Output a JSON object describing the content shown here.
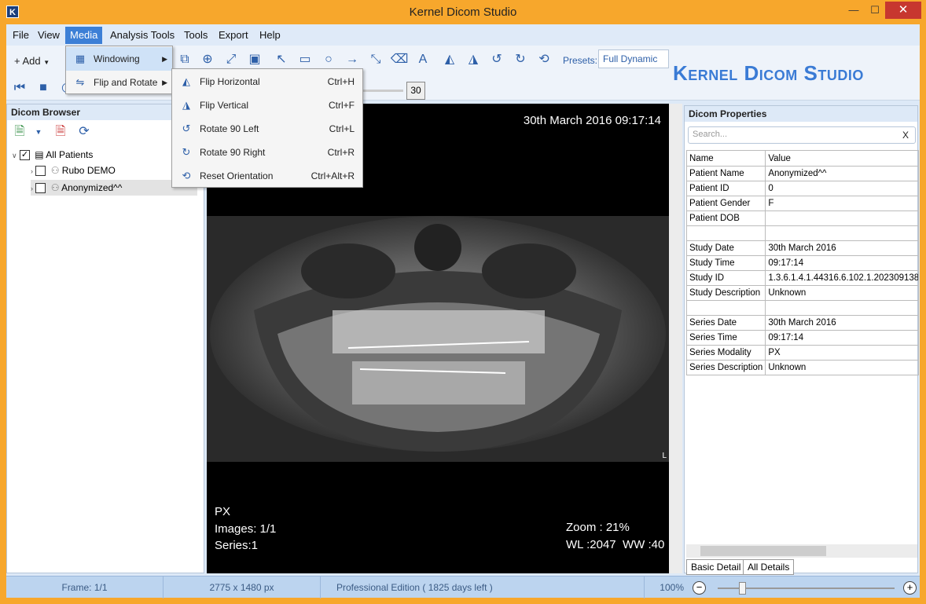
{
  "window": {
    "title": "Kernel Dicom Studio",
    "app_icon_letter": "K",
    "min": "—",
    "max": "☐",
    "close": "✕"
  },
  "menubar": {
    "items": [
      "File",
      "View",
      "Media",
      "Analysis Tools",
      "Tools",
      "Export",
      "Help"
    ],
    "active": "Media"
  },
  "toolbar": {
    "add_label": "+ Add",
    "presets_label": "Presets:",
    "presets_value": "Full Dynamic",
    "frame_value": "30",
    "brand": "Kernel Dicom Studio"
  },
  "media_menu": [
    {
      "label": "Windowing",
      "icon": "windowing-icon"
    },
    {
      "label": "Flip and Rotate",
      "icon": "flip-rotate-icon"
    }
  ],
  "flip_menu": [
    {
      "label": "Flip Horizontal",
      "shortcut": "Ctrl+H",
      "icon": "flip-horizontal-icon"
    },
    {
      "label": "Flip Vertical",
      "shortcut": "Ctrl+F",
      "icon": "flip-vertical-icon"
    },
    {
      "label": "Rotate 90 Left",
      "shortcut": "Ctrl+L",
      "icon": "rotate-left-icon"
    },
    {
      "label": "Rotate 90 Right",
      "shortcut": "Ctrl+R",
      "icon": "rotate-right-icon"
    },
    {
      "label": "Reset Orientation",
      "shortcut": "Ctrl+Alt+R",
      "icon": "reset-orientation-icon"
    }
  ],
  "left_panel": {
    "title": "Dicom Browser",
    "tree": [
      {
        "label": "All Patients",
        "checked": true
      },
      {
        "label": "Rubo DEMO",
        "checked": false
      },
      {
        "label": "Anonymized^^",
        "checked": false
      }
    ]
  },
  "viewer": {
    "datetime": "30th March 2016 09:17:14",
    "modality": "PX",
    "images": "Images: 1/1",
    "series": "Series:1",
    "zoom": "Zoom : 21%",
    "wl_ww": "WL :2047  WW :40",
    "orientation_marker": "L"
  },
  "right_panel": {
    "title": "Dicom Properties",
    "search_placeholder": "Search...",
    "search_clear": "X",
    "col_name": "Name",
    "col_value": "Value",
    "rows": [
      [
        "Patient Name",
        "Anonymized^^"
      ],
      [
        "Patient ID",
        "0"
      ],
      [
        "Patient Gender",
        "F"
      ],
      [
        "Patient DOB",
        ""
      ],
      [
        "",
        ""
      ],
      [
        "Study Date",
        "30th March 2016"
      ],
      [
        "Study Time",
        "09:17:14"
      ],
      [
        "Study ID",
        "1.3.6.1.4.1.44316.6.102.1.202309138"
      ],
      [
        "Study Description",
        "Unknown"
      ],
      [
        "",
        ""
      ],
      [
        "Series Date",
        "30th March 2016"
      ],
      [
        "Series Time",
        "09:17:14"
      ],
      [
        "Series Modality",
        "PX"
      ],
      [
        "Series Description",
        "Unknown"
      ]
    ],
    "tabs": [
      "Basic Detail",
      "All Details"
    ]
  },
  "statusbar": {
    "frame": "Frame: 1/1",
    "dimensions": "2775 x 1480 px",
    "edition": "Professional Edition ( 1825 days left )",
    "zoom": "100%",
    "zoom_minus": "−",
    "zoom_plus": "+"
  }
}
